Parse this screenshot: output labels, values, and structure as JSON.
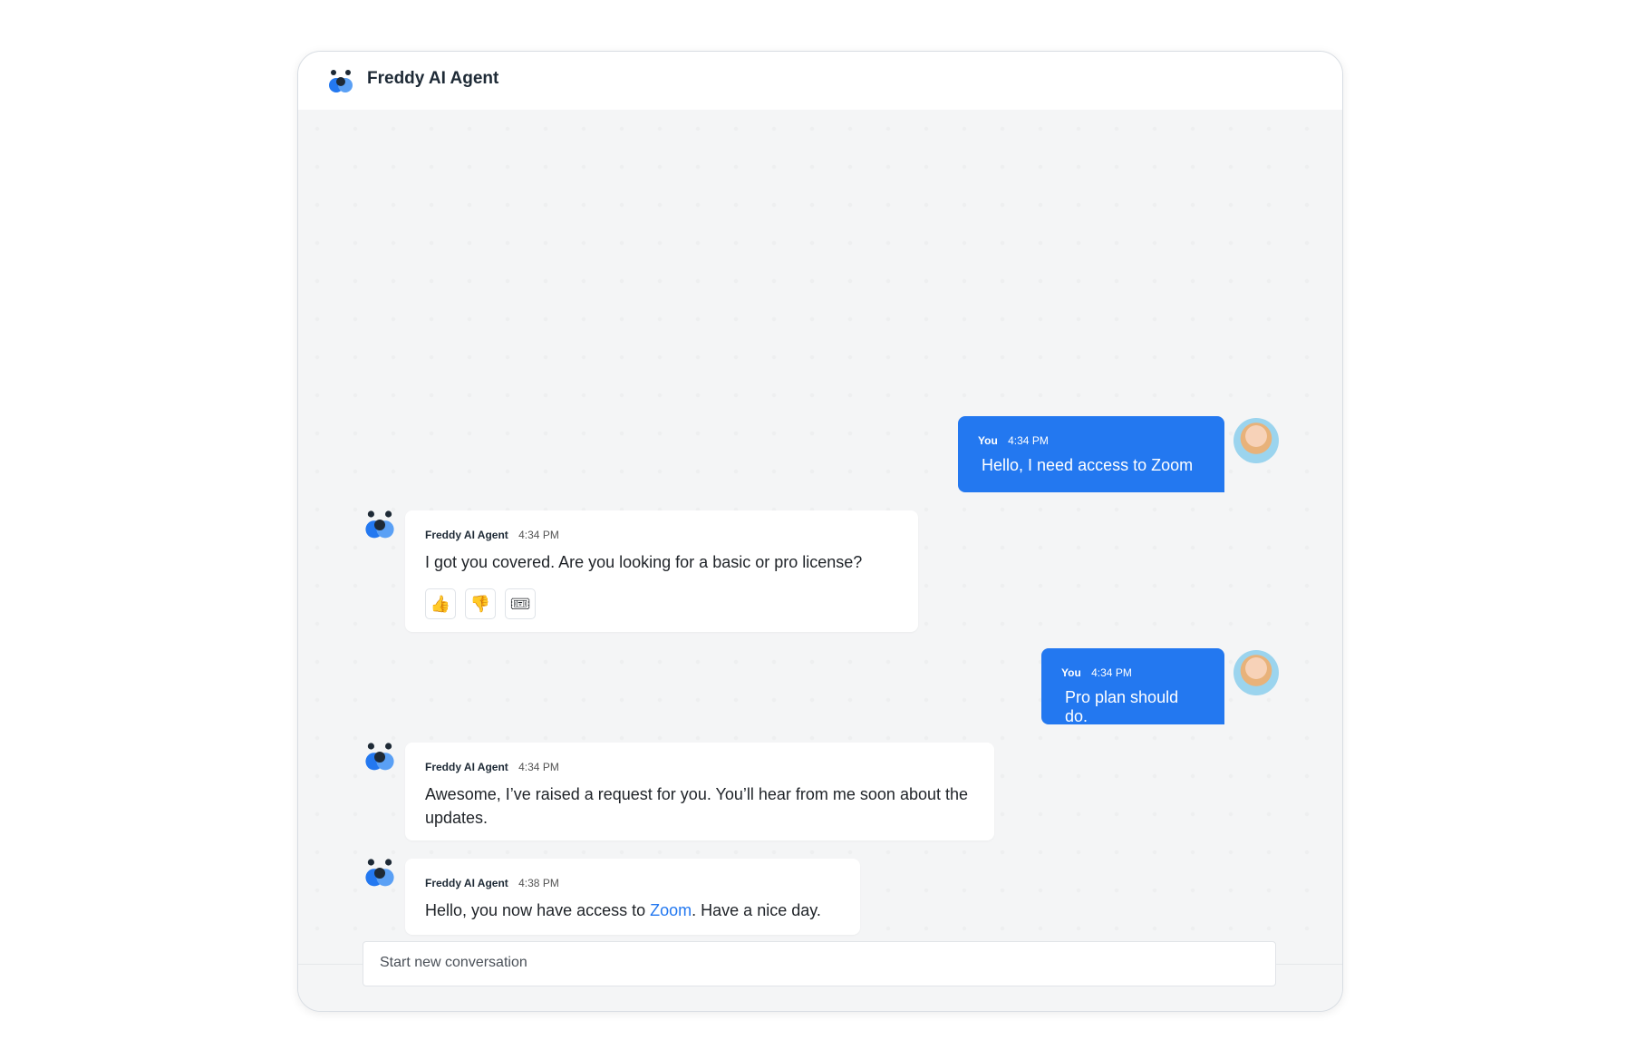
{
  "header": {
    "title": "Freddy AI Agent"
  },
  "colors": {
    "user_bubble": "#2378f0",
    "link": "#2378f0"
  },
  "messages": [
    {
      "from": "user",
      "sender": "You",
      "time": "4:34 PM",
      "text": "Hello, I need access to Zoom"
    },
    {
      "from": "bot",
      "sender": "Freddy AI Agent",
      "time": "4:34 PM",
      "text": "I got you covered. Are you looking for a basic or pro license?",
      "feedback": [
        {
          "icon": "thumbs-up-icon",
          "glyph": "👍"
        },
        {
          "icon": "thumbs-down-icon",
          "glyph": "👎"
        },
        {
          "icon": "ticket-icon",
          "glyph": "🎟"
        }
      ]
    },
    {
      "from": "user",
      "sender": "You",
      "time": "4:34 PM",
      "text": "Pro plan should do."
    },
    {
      "from": "bot",
      "sender": "Freddy AI Agent",
      "time": "4:34 PM",
      "text": "Awesome, I’ve raised a request for you. You’ll hear from me soon about the updates."
    },
    {
      "from": "bot",
      "sender": "Freddy AI Agent",
      "time": "4:38 PM",
      "text_before": "Hello, you now have access to ",
      "link": "Zoom",
      "text_after": ". Have a nice day."
    }
  ],
  "composer": {
    "placeholder": "Start new conversation"
  }
}
